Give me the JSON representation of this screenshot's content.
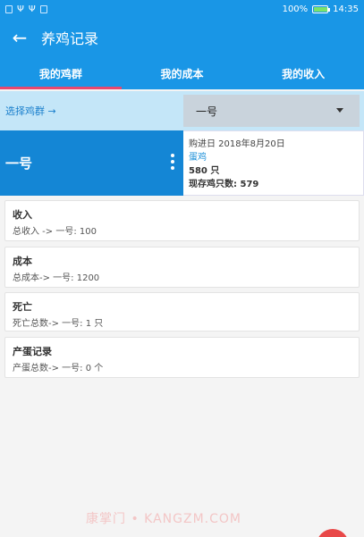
{
  "status_bar": {
    "battery": "100%",
    "time": "14:35",
    "battery_level": 1.0
  },
  "app_bar": {
    "title": "养鸡记录"
  },
  "tabs": [
    {
      "label": "我的鸡群",
      "active": true
    },
    {
      "label": "我的成本",
      "active": false
    },
    {
      "label": "我的收入",
      "active": false
    }
  ],
  "selector": {
    "label": "选择鸡群 →",
    "selected": "一号"
  },
  "flock": {
    "name": "一号",
    "purchase_date": "购进日 2018年8月20日",
    "type": "蛋鸡",
    "count": "580 只",
    "current": "现存鸡只数: 579"
  },
  "cards": [
    {
      "title": "收入",
      "subtitle": "总收入 -> 一号: 100"
    },
    {
      "title": "成本",
      "subtitle": "总成本-> 一号: 1200"
    },
    {
      "title": "死亡",
      "subtitle": "死亡总数-> 一号: 1 只"
    },
    {
      "title": "产蛋记录",
      "subtitle": "产蛋总数-> 一号: 0 个"
    }
  ],
  "watermark": "康掌门 • KANGZM.COM",
  "colors": {
    "primary": "#1996e6",
    "tab_indicator": "#e8476e",
    "fab": "#e84848"
  }
}
